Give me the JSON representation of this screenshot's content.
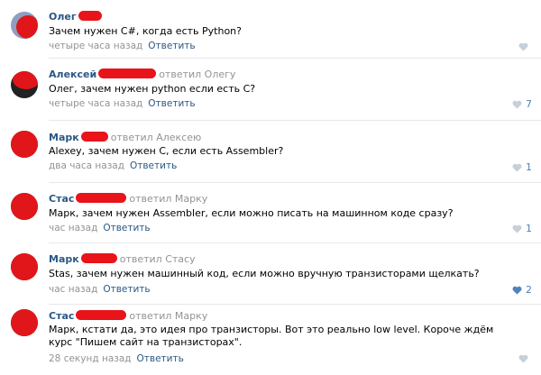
{
  "comments": [
    {
      "author": "Олег",
      "reply_to": "",
      "text": "Зачем нужен C#, когда есть Python?",
      "time": "четыре часа назад",
      "reply_label": "Ответить",
      "likes": ""
    },
    {
      "author": "Алексей",
      "reply_to": "ответил Олегу",
      "text": "Олег, зачем нужен python если есть С?",
      "time": "четыре часа назад",
      "reply_label": "Ответить",
      "likes": "7"
    },
    {
      "author": "Марк",
      "reply_to": "ответил Алексею",
      "text": "Alexey, зачем нужен С, если есть Assembler?",
      "time": "два часа назад",
      "reply_label": "Ответить",
      "likes": "1"
    },
    {
      "author": "Стас",
      "reply_to": "ответил Марку",
      "text": "Марк, зачем нужен Assembler, если можно писать на машинном коде сразу?",
      "time": "час назад",
      "reply_label": "Ответить",
      "likes": "1"
    },
    {
      "author": "Марк",
      "reply_to": "ответил Стасу",
      "text": "Stas, зачем нужен машинный код, если можно вручную транзисторами щелкать?",
      "time": "час назад",
      "reply_label": "Ответить",
      "likes": "2"
    },
    {
      "author": "Стас",
      "reply_to": "ответил Марку",
      "text": "Марк, кстати да, это идея про транзисторы. Вот это реально low level. Короче ждём курс \"Пишем сайт на транзисторах\".",
      "time": "28 секунд назад",
      "reply_label": "Ответить",
      "likes": ""
    }
  ],
  "icons": {
    "like": "heart-icon"
  },
  "colors": {
    "link": "#2a5885",
    "muted": "#939393",
    "accent": "#5181b8",
    "redaction": "#e8141a"
  }
}
